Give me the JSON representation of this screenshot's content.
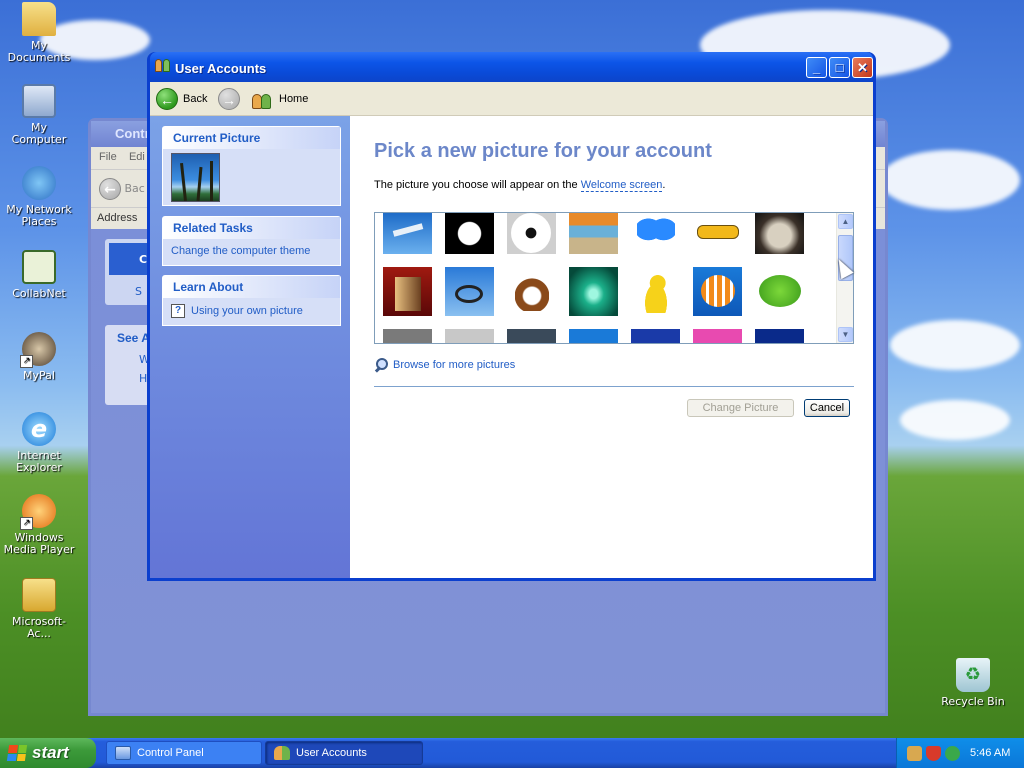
{
  "desktop": {
    "icons": [
      {
        "label": "My Documents",
        "icon": "folder-icon"
      },
      {
        "label": "My Computer",
        "icon": "computer-icon"
      },
      {
        "label": "My Network Places",
        "icon": "network-icon"
      },
      {
        "label": "CollabNet",
        "icon": "collabnet-icon"
      },
      {
        "label": "MyPal",
        "icon": "mypal-icon"
      },
      {
        "label": "Internet Explorer",
        "icon": "internet-explorer-icon"
      },
      {
        "label": "Windows Media Player",
        "icon": "media-player-icon"
      },
      {
        "label": "Microsoft-Ac...",
        "icon": "zip-folder-icon"
      },
      {
        "label": "Recycle Bin",
        "icon": "recycle-bin-icon"
      }
    ]
  },
  "background_window": {
    "title": "Contr",
    "menu_file": "File",
    "menu_edit": "Edi",
    "back_label": "Bac",
    "address_label": "Address",
    "pane_text_1": "Co",
    "pane_text_2": "S",
    "see_also": "See A",
    "item_w": "W",
    "item_h": "H"
  },
  "window": {
    "title": "User Accounts",
    "nav": {
      "back": "Back",
      "home": "Home"
    },
    "sidebar": {
      "current_picture_header": "Current Picture",
      "related_tasks_header": "Related Tasks",
      "related_task_1": "Change the computer theme",
      "learn_about_header": "Learn About",
      "learn_item_1": "Using your own picture"
    },
    "content": {
      "heading": "Pick a new picture for your account",
      "description_prefix": "The picture you choose will appear on the ",
      "description_link": "Welcome screen",
      "description_suffix": ".",
      "browse_label": "Browse for more pictures",
      "change_button": "Change Picture",
      "cancel_button": "Cancel"
    },
    "pictures": [
      {
        "name": "airplane"
      },
      {
        "name": "astronaut"
      },
      {
        "name": "soccer ball"
      },
      {
        "name": "beach chairs"
      },
      {
        "name": "butterfly"
      },
      {
        "name": "race car"
      },
      {
        "name": "owl"
      },
      {
        "name": "chess"
      },
      {
        "name": "dirt bike"
      },
      {
        "name": "dog"
      },
      {
        "name": "drip"
      },
      {
        "name": "duck"
      },
      {
        "name": "fish"
      },
      {
        "name": "frog"
      }
    ]
  },
  "taskbar": {
    "start_label": "start",
    "tasks": [
      {
        "label": "Control Panel",
        "active": false
      },
      {
        "label": "User Accounts",
        "active": true
      }
    ],
    "clock": "5:46 AM"
  },
  "colors": {
    "xp_blue": "#0c44c9",
    "link_blue": "#215dc6",
    "heading_blue": "#6c87c9",
    "start_green": "#3c9a3a"
  }
}
